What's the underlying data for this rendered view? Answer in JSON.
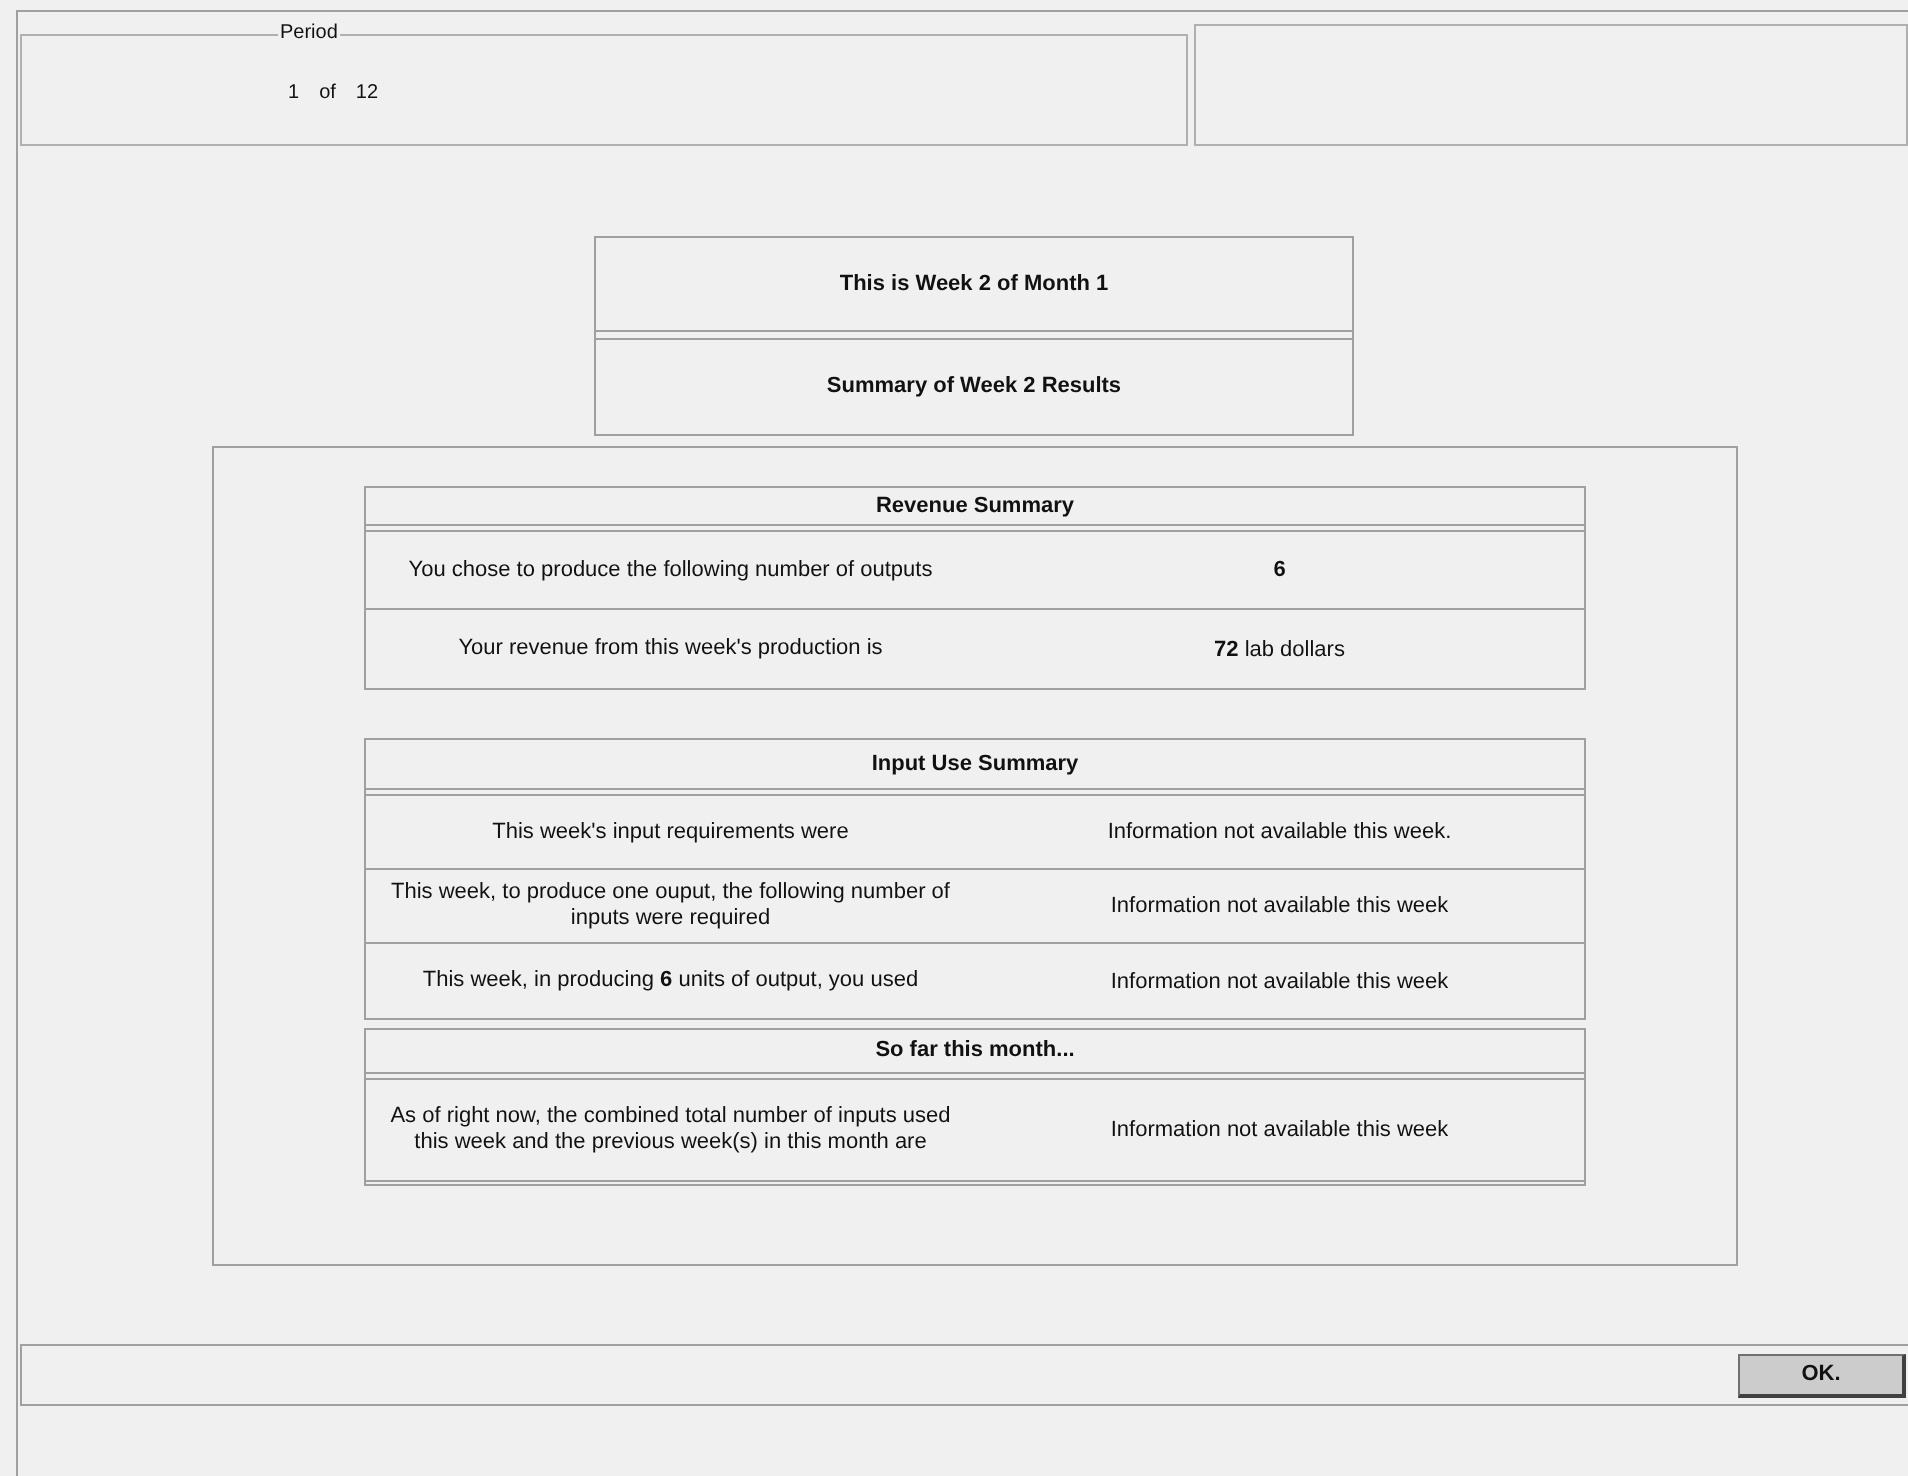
{
  "period": {
    "legend": "Period",
    "current": "1",
    "of": "of",
    "total": "12"
  },
  "header": {
    "title": "This is Week 2 of Month 1",
    "subtitle": "Summary of Week 2 Results"
  },
  "sections": [
    {
      "title": "Revenue Summary",
      "rows": [
        {
          "label": "You chose to produce the following number of outputs",
          "value": "6",
          "value_bold": true
        },
        {
          "label": "Your revenue from this week's production is",
          "value": "**72** lab dollars",
          "value_bold": false
        }
      ]
    },
    {
      "title": "Input Use Summary",
      "rows": [
        {
          "label": "This week's input requirements were",
          "value": "Information not available this week.",
          "value_bold": false
        },
        {
          "label": "This week, to produce one ouput, the following number of inputs were required",
          "value": "Information not available this week",
          "value_bold": false
        },
        {
          "label": "This week, in producing **6** units of output, you used",
          "value": "Information not available this week",
          "value_bold": false
        }
      ]
    },
    {
      "title": "So far this month...",
      "rows": [
        {
          "label": "As of right now, the combined total number of inputs used this week and the previous week(s) in this month are",
          "value": "Information not available this week",
          "value_bold": false
        }
      ]
    }
  ],
  "button": "OK."
}
